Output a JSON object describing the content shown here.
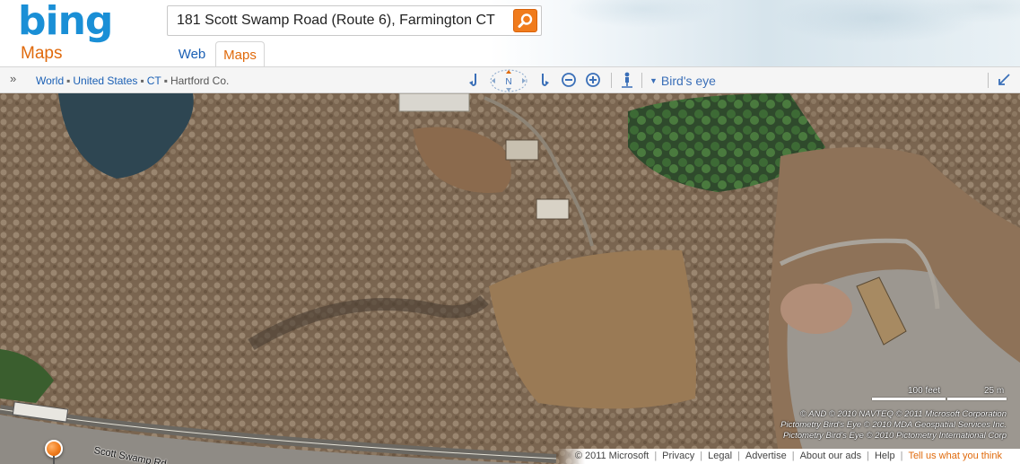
{
  "brand": {
    "logo_text": "bing",
    "product": "Maps",
    "logo_color": "#1a8fd6",
    "accent_color": "#e06a0c"
  },
  "search": {
    "value": "181 Scott Swamp Road (Route 6), Farmington CT",
    "button_icon": "search-icon"
  },
  "tabs": [
    {
      "label": "Web",
      "active": false
    },
    {
      "label": "Maps",
      "active": true
    }
  ],
  "toolbar": {
    "expand_icon": "double-chevron-right-icon",
    "breadcrumb": [
      "World",
      "United States",
      "CT",
      "Hartford Co."
    ],
    "compass_label": "N",
    "tools": [
      "rotate-left-icon",
      "compass-icon",
      "rotate-right-icon",
      "zoom-out-icon",
      "zoom-in-icon",
      "street-side-person-icon"
    ],
    "view_mode": "Bird's eye",
    "collapse_icon": "collapse-arrow-icon"
  },
  "map": {
    "road_label": "Scott Swamp Rd",
    "scale_feet": "100 feet",
    "scale_meters": "25 m",
    "copyright_lines": [
      "© AND   © 2010 NAVTEQ   © 2011 Microsoft Corporation",
      "Pictometry Bird's Eye © 2010 MDA Geospatial Services Inc.",
      "Pictometry Bird's Eye © 2010 Pictometry International Corp"
    ],
    "pin_color": "#f07b1c"
  },
  "footer": {
    "copyright": "© 2011 Microsoft",
    "links": [
      "Privacy",
      "Legal",
      "Advertise",
      "About our ads",
      "Help"
    ],
    "feedback": "Tell us what you think"
  }
}
